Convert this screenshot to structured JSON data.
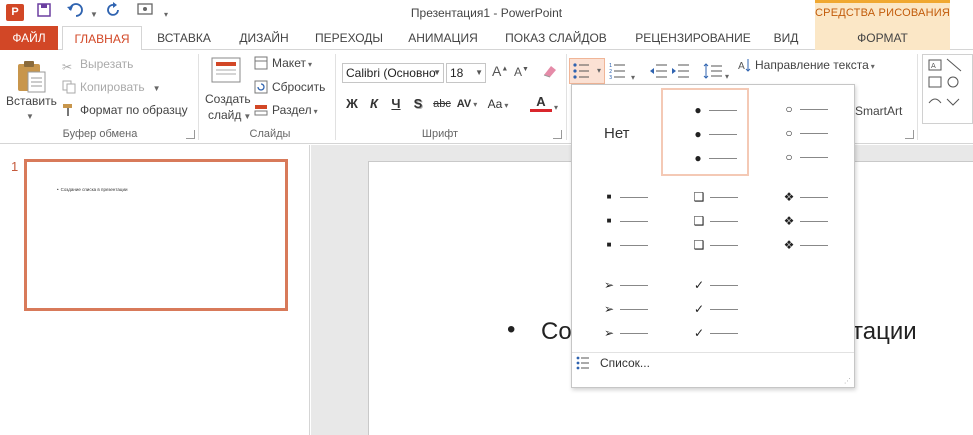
{
  "window": {
    "title": "Презентация1 - PowerPoint",
    "app_icon_letter": "P",
    "contextual_group": "СРЕДСТВА РИСОВАНИЯ",
    "qat_icons": [
      "save-icon",
      "undo-icon",
      "redo-icon",
      "presenter-icon",
      "customize-icon"
    ]
  },
  "tabs": [
    "ФАЙЛ",
    "ГЛАВНАЯ",
    "ВСТАВКА",
    "ДИЗАЙН",
    "ПЕРЕХОДЫ",
    "АНИМАЦИЯ",
    "ПОКАЗ СЛАЙДОВ",
    "РЕЦЕНЗИРОВАНИЕ",
    "ВИД",
    "ФОРМАТ"
  ],
  "ribbon": {
    "clipboard": {
      "label": "Буфер обмена",
      "paste": "Вставить",
      "cut": "Вырезать",
      "copy": "Копировать",
      "format_painter": "Формат по образцу"
    },
    "slides": {
      "label": "Слайды",
      "new_slide_line1": "Создать",
      "new_slide_line2": "слайд",
      "layout": "Макет",
      "reset": "Сбросить",
      "section": "Раздел"
    },
    "font": {
      "label": "Шрифт",
      "font_name": "Calibri (Основно",
      "font_size": "18",
      "bold": "Ж",
      "italic": "К",
      "underline": "Ч",
      "shadow": "S",
      "strikethrough": "abc",
      "spacing": "AV",
      "case": "Aa",
      "color": "A"
    },
    "paragraph": {
      "text_direction": "Направление текста",
      "smartart": "SmartArt"
    },
    "accent_color": "#d24726"
  },
  "bullet_gallery": {
    "none_label": "Нет",
    "list_link": "Список...",
    "styles": [
      "none",
      "filled-dot",
      "hollow-circle",
      "filled-square",
      "hollow-square",
      "diamond-star",
      "arrowhead",
      "checkmark"
    ]
  },
  "thumbnail": {
    "slide_number": "1",
    "text": "Создание списка в презентации"
  },
  "slide": {
    "bullet": "•",
    "text_visible": "Со",
    "text_visible_end": "тации"
  }
}
